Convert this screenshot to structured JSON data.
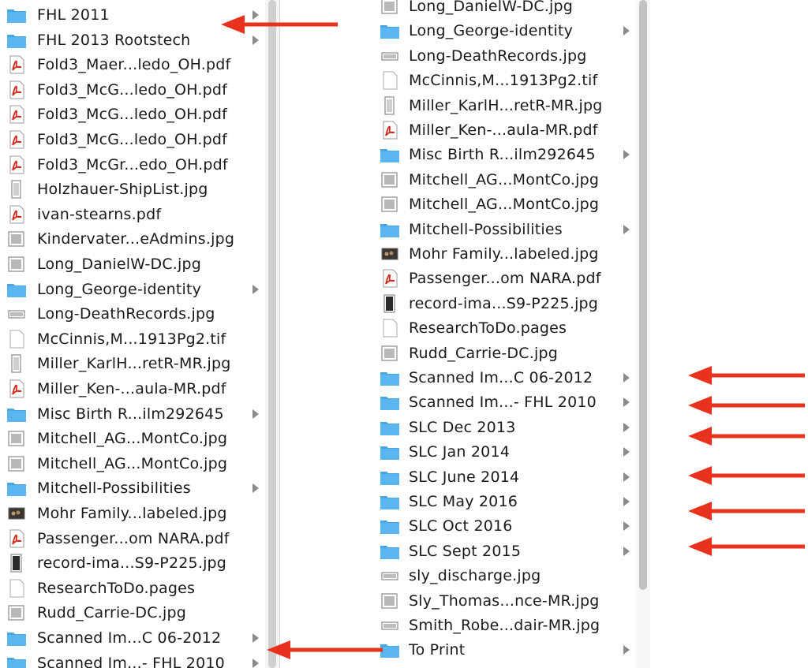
{
  "left_column": [
    {
      "name": "FHL 2011",
      "icon": "folder-icon",
      "folder": true
    },
    {
      "name": "FHL 2013 Rootstech",
      "icon": "folder-icon",
      "folder": true
    },
    {
      "name": "Fold3_Maer...ledo_OH.pdf",
      "icon": "pdf-icon",
      "folder": false
    },
    {
      "name": "Fold3_McG...ledo_OH.pdf",
      "icon": "pdf-icon",
      "folder": false
    },
    {
      "name": "Fold3_McG...ledo_OH.pdf",
      "icon": "pdf-icon",
      "folder": false
    },
    {
      "name": "Fold3_McG...ledo_OH.pdf",
      "icon": "pdf-icon",
      "folder": false
    },
    {
      "name": "Fold3_McGr...edo_OH.pdf",
      "icon": "pdf-icon",
      "folder": false
    },
    {
      "name": "Holzhauer-ShipList.jpg",
      "icon": "tall-image-icon",
      "folder": false
    },
    {
      "name": "ivan-stearns.pdf",
      "icon": "pdf-icon",
      "folder": false
    },
    {
      "name": "Kindervater...eAdmins.jpg",
      "icon": "image-icon",
      "folder": false
    },
    {
      "name": "Long_DanielW-DC.jpg",
      "icon": "image-icon",
      "folder": false
    },
    {
      "name": "Long_George-identity",
      "icon": "folder-icon",
      "folder": true
    },
    {
      "name": "Long-DeathRecords.jpg",
      "icon": "wide-image-icon",
      "folder": false
    },
    {
      "name": "McCinnis,M...1913Pg2.tif",
      "icon": "document-icon",
      "folder": false
    },
    {
      "name": "Miller_KarlH...retR-MR.jpg",
      "icon": "tall-image-icon",
      "folder": false
    },
    {
      "name": "Miller_Ken-...aula-MR.pdf",
      "icon": "pdf-icon",
      "folder": false
    },
    {
      "name": "Misc Birth R...ilm292645",
      "icon": "folder-icon",
      "folder": true
    },
    {
      "name": "Mitchell_AG...MontCo.jpg",
      "icon": "image-icon",
      "folder": false
    },
    {
      "name": "Mitchell_AG...MontCo.jpg",
      "icon": "image-icon",
      "folder": false
    },
    {
      "name": "Mitchell-Possibilities",
      "icon": "folder-icon",
      "folder": true
    },
    {
      "name": "Mohr Family...labeled.jpg",
      "icon": "photo-icon",
      "folder": false
    },
    {
      "name": "Passenger...om NARA.pdf",
      "icon": "pdf-icon",
      "folder": false
    },
    {
      "name": "record-ima...S9-P225.jpg",
      "icon": "dark-image-icon",
      "folder": false
    },
    {
      "name": "ResearchToDo.pages",
      "icon": "document-icon",
      "folder": false
    },
    {
      "name": "Rudd_Carrie-DC.jpg",
      "icon": "image-icon",
      "folder": false
    },
    {
      "name": "Scanned Im...C 06-2012",
      "icon": "folder-icon",
      "folder": true
    },
    {
      "name": "Scanned Im...- FHL 2010",
      "icon": "folder-icon",
      "folder": true
    }
  ],
  "right_column": [
    {
      "name": "Long_DanielW-DC.jpg",
      "icon": "image-icon",
      "folder": false
    },
    {
      "name": "Long_George-identity",
      "icon": "folder-icon",
      "folder": true
    },
    {
      "name": "Long-DeathRecords.jpg",
      "icon": "wide-image-icon",
      "folder": false
    },
    {
      "name": "McCinnis,M...1913Pg2.tif",
      "icon": "document-icon",
      "folder": false
    },
    {
      "name": "Miller_KarlH...retR-MR.jpg",
      "icon": "tall-image-icon",
      "folder": false
    },
    {
      "name": "Miller_Ken-...aula-MR.pdf",
      "icon": "pdf-icon",
      "folder": false
    },
    {
      "name": "Misc Birth R...ilm292645",
      "icon": "folder-icon",
      "folder": true
    },
    {
      "name": "Mitchell_AG...MontCo.jpg",
      "icon": "image-icon",
      "folder": false
    },
    {
      "name": "Mitchell_AG...MontCo.jpg",
      "icon": "image-icon",
      "folder": false
    },
    {
      "name": "Mitchell-Possibilities",
      "icon": "folder-icon",
      "folder": true
    },
    {
      "name": "Mohr Family...labeled.jpg",
      "icon": "photo-icon",
      "folder": false
    },
    {
      "name": "Passenger...om NARA.pdf",
      "icon": "pdf-icon",
      "folder": false
    },
    {
      "name": "record-ima...S9-P225.jpg",
      "icon": "dark-image-icon",
      "folder": false
    },
    {
      "name": "ResearchToDo.pages",
      "icon": "document-icon",
      "folder": false
    },
    {
      "name": "Rudd_Carrie-DC.jpg",
      "icon": "image-icon",
      "folder": false
    },
    {
      "name": "Scanned Im...C 06-2012",
      "icon": "folder-icon",
      "folder": true
    },
    {
      "name": "Scanned Im...- FHL 2010",
      "icon": "folder-icon",
      "folder": true
    },
    {
      "name": "SLC Dec 2013",
      "icon": "folder-icon",
      "folder": true
    },
    {
      "name": "SLC Jan 2014",
      "icon": "folder-icon",
      "folder": true
    },
    {
      "name": "SLC June 2014",
      "icon": "folder-icon",
      "folder": true
    },
    {
      "name": "SLC May 2016",
      "icon": "folder-icon",
      "folder": true
    },
    {
      "name": "SLC Oct 2016",
      "icon": "folder-icon",
      "folder": true
    },
    {
      "name": "SLC Sept 2015",
      "icon": "folder-icon",
      "folder": true
    },
    {
      "name": "sly_discharge.jpg",
      "icon": "wide-image-icon",
      "folder": false
    },
    {
      "name": "Sly_Thomas...nce-MR.jpg",
      "icon": "image-icon",
      "folder": false
    },
    {
      "name": "Smith_Robe...dair-MR.jpg",
      "icon": "wide-image-icon",
      "folder": false
    },
    {
      "name": "To Print",
      "icon": "folder-icon",
      "folder": true
    }
  ],
  "annotation_arrows": [
    {
      "name": "annotation-arrow-fhl-2011",
      "color": "#e8321e"
    },
    {
      "name": "annotation-arrow-scanned-fhl-2010",
      "color": "#e8321e"
    },
    {
      "name": "annotation-arrow-scanned-c-06-2012",
      "color": "#e8321e"
    },
    {
      "name": "annotation-arrow-scanned-fhl-2010-right",
      "color": "#e8321e"
    },
    {
      "name": "annotation-arrow-slc-dec-2013",
      "color": "#e8321e"
    },
    {
      "name": "annotation-arrow-slc-june-2014",
      "color": "#e8321e"
    },
    {
      "name": "annotation-arrow-slc-may-2016",
      "color": "#e8321e"
    },
    {
      "name": "annotation-arrow-slc-sept-2015",
      "color": "#e8321e"
    }
  ],
  "colors": {
    "folder": "#5bb5ef",
    "folder_tab": "#4aa6e2",
    "pdf": "#d42a1c",
    "chevron": "#8a8a8a",
    "arrow": "#e8321e"
  }
}
